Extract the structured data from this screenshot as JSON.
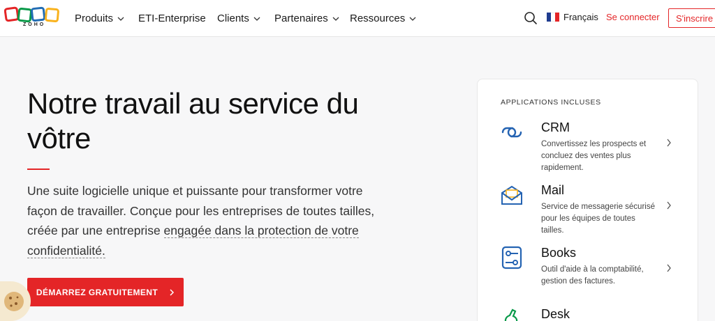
{
  "header": {
    "logo_text": "ZOHO",
    "nav": [
      {
        "label": "Produits",
        "has_dropdown": true
      },
      {
        "label": "ETI-Enterprise",
        "has_dropdown": false
      },
      {
        "label": "Clients",
        "has_dropdown": true
      },
      {
        "label": "Partenaires",
        "has_dropdown": true
      },
      {
        "label": "Ressources",
        "has_dropdown": true
      }
    ],
    "language": "Français",
    "login": "Se connecter",
    "signup": "S'inscrire"
  },
  "hero": {
    "title": "Notre travail au service du vôtre",
    "desc_before": "Une suite logicielle unique et puissante pour transformer votre façon de travailler. Conçue pour les entreprises de toutes tailles, créée par une entreprise ",
    "desc_link": "engagée dans la protection de votre confidentialité.",
    "cta": "DÉMARREZ GRATUITEMENT"
  },
  "apps_panel": {
    "title": "APPLICATIONS INCLUSES",
    "apps": [
      {
        "name": "CRM",
        "desc": "Convertissez les prospects et concluez des ventes plus rapidement."
      },
      {
        "name": "Mail",
        "desc": "Service de messagerie sécurisé pour les équipes de toutes tailles."
      },
      {
        "name": "Books",
        "desc": "Outil d'aide à la comptabilité, gestion des factures."
      },
      {
        "name": "Desk",
        "desc": ""
      }
    ]
  },
  "colors": {
    "accent": "#e42527",
    "icon_blue": "#2463b2",
    "logo_red": "#e42527",
    "logo_green": "#089949",
    "logo_blue": "#226db4",
    "logo_yellow": "#f9b21d"
  }
}
